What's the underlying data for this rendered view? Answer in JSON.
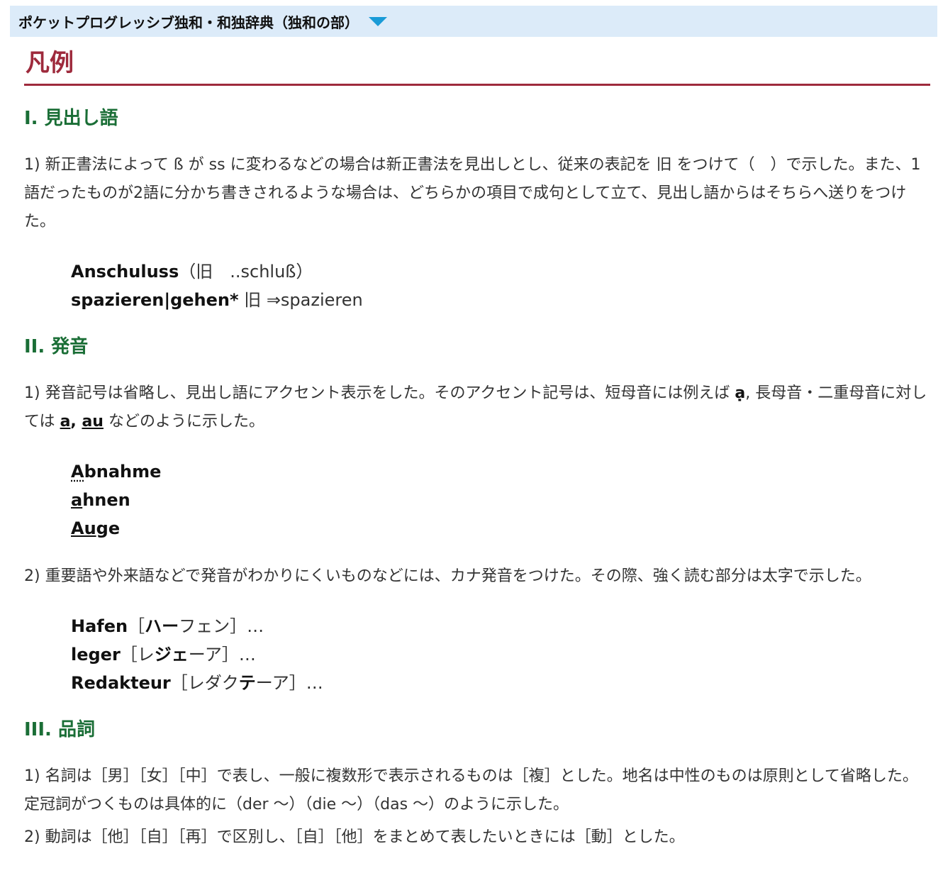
{
  "header": {
    "title": "ポケットプログレッシブ独和・和独辞典（独和の部）"
  },
  "page_title": "凡例",
  "sections": {
    "s1": {
      "heading": "I.  見出し語",
      "p1": "1) 新正書法によって ß が ss に変わるなどの場合は新正書法を見出しとし、従来の表記を 旧 をつけて（　）で示した。また、1語だったものが2語に分かち書きされるような場合は、どちらかの項目で成句として立て、見出し語からはそちらへ送りをつけた。",
      "ex1_hw": "Anschuluss",
      "ex1_rest": "（旧　..schluß）",
      "ex2_hw": "spazieren|gehen*",
      "ex2_rest": " 旧 ⇒spazieren"
    },
    "s2": {
      "heading": "II.  発音",
      "p1_a": "1) 発音記号は省略し、見出し語にアクセント表示をした。そのアクセント記号は、短母音には例えば ",
      "p1_mark1": "ạ",
      "p1_b": ", 長母音・二重母音に対しては ",
      "p1_mark2": "a",
      "p1_c": ", ",
      "p1_mark3": "au",
      "p1_d": " などのように示した。",
      "w1_a": "A",
      "w1_b": "bnahme",
      "w2_a": "a",
      "w2_b": "hnen",
      "w3_a": "Au",
      "w3_b": "ge",
      "p2": "2) 重要語や外来語などで発音がわかりにくいものなどには、カナ発音をつけた。その際、強く読む部分は太字で示した。",
      "k1_hw": "Hafen",
      "k1_o": "［",
      "k1_b": "ハー",
      "k1_r": "フェン］…",
      "k2_hw": "leger",
      "k2_o": "［レ",
      "k2_b": "ジェ",
      "k2_r": "ーア］…",
      "k3_hw": "Redakteur",
      "k3_o": "［レダク",
      "k3_b": "テ",
      "k3_r": "ーア］…"
    },
    "s3": {
      "heading": "III.  品詞",
      "p1": "1) 名詞は［男］［女］［中］で表し、一般に複数形で表示されるものは［複］とした。地名は中性のものは原則として省略した。定冠詞がつくものは具体的に（der ～）（die ～）（das ～）のように示した。",
      "p2": "2) 動詞は［他］［自］［再］で区別し、［自］［他］をまとめて表したいときには［動］とした。"
    }
  },
  "colors": {
    "accent": "#9e2a3c",
    "heading": "#1a6e36",
    "bar": "#dcebf9",
    "triangle": "#1a9bd7"
  }
}
